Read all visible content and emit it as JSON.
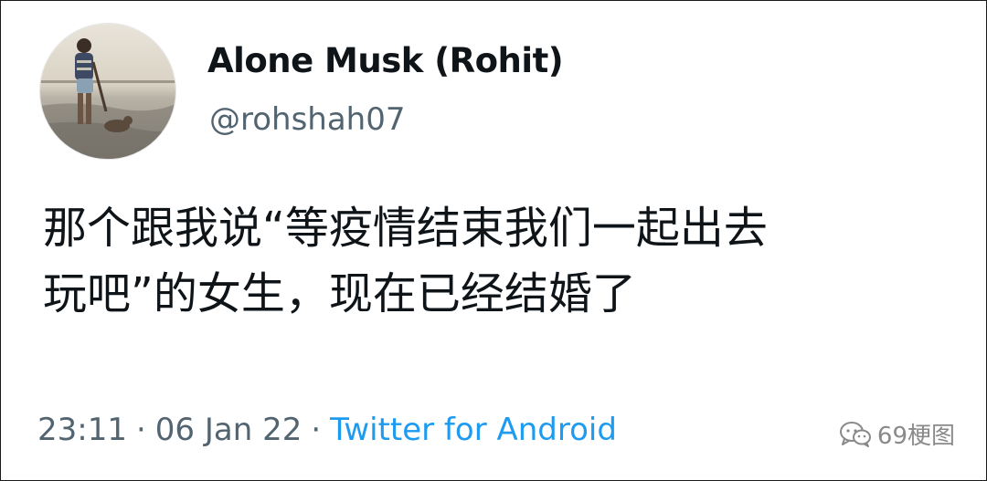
{
  "tweet": {
    "author": {
      "display_name": "Alone Musk (Rohit)",
      "handle": "@rohshah07",
      "avatar_icon": "profile-photo"
    },
    "text_lines": [
      "那个跟我说“等疫情结束我们一起出去",
      "玩吧”的女生，现在已经结婚了"
    ],
    "meta": {
      "time": "23:11",
      "separator": "·",
      "date": "06 Jan 22",
      "source": "Twitter for Android"
    },
    "colors": {
      "text": "#0f1419",
      "secondary": "#536471",
      "link": "#1d9bf0"
    }
  },
  "watermark": {
    "icon": "wechat-icon",
    "text": "69梗图"
  }
}
